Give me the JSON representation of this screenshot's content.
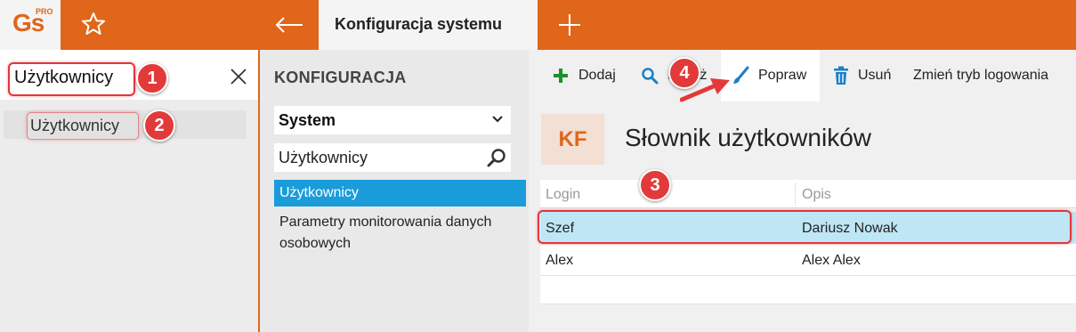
{
  "app": {
    "logo_text": "Gs",
    "logo_superscript": "PRO",
    "brand_color": "#e0661a",
    "accent_color": "#1a9cdb",
    "annotation_color": "#e23a3a"
  },
  "topbar": {
    "favorite_icon": "star-icon",
    "back_icon": "arrow-left-icon",
    "active_tab_title": "Konfiguracja systemu",
    "new_tab_icon": "plus-icon"
  },
  "left_search": {
    "value": "Użytkownicy",
    "clear_icon": "close-icon",
    "results": [
      "Użytkownicy"
    ]
  },
  "config_panel": {
    "header": "KONFIGURACJA",
    "section_select": "System",
    "filter_value": "Użytkownicy",
    "items": [
      {
        "label": "Użytkownicy",
        "selected": true
      },
      {
        "label": "Parametry monitorowania danych osobowych",
        "selected": false
      }
    ]
  },
  "toolbar": {
    "add_label": "Dodaj",
    "show_label": "Pokaż",
    "edit_label": "Popraw",
    "delete_label": "Usuń",
    "login_mode_label": "Zmień tryb logowania"
  },
  "dictionary": {
    "badge": "KF",
    "title": "Słownik użytkowników",
    "columns": [
      "Login",
      "Opis"
    ],
    "rows": [
      {
        "login": "Szef",
        "opis": "Dariusz Nowak",
        "selected": true
      },
      {
        "login": "Alex",
        "opis": "Alex Alex",
        "selected": false
      }
    ]
  },
  "annotations": {
    "step1": "1",
    "step2": "2",
    "step3": "3",
    "step4": "4"
  }
}
